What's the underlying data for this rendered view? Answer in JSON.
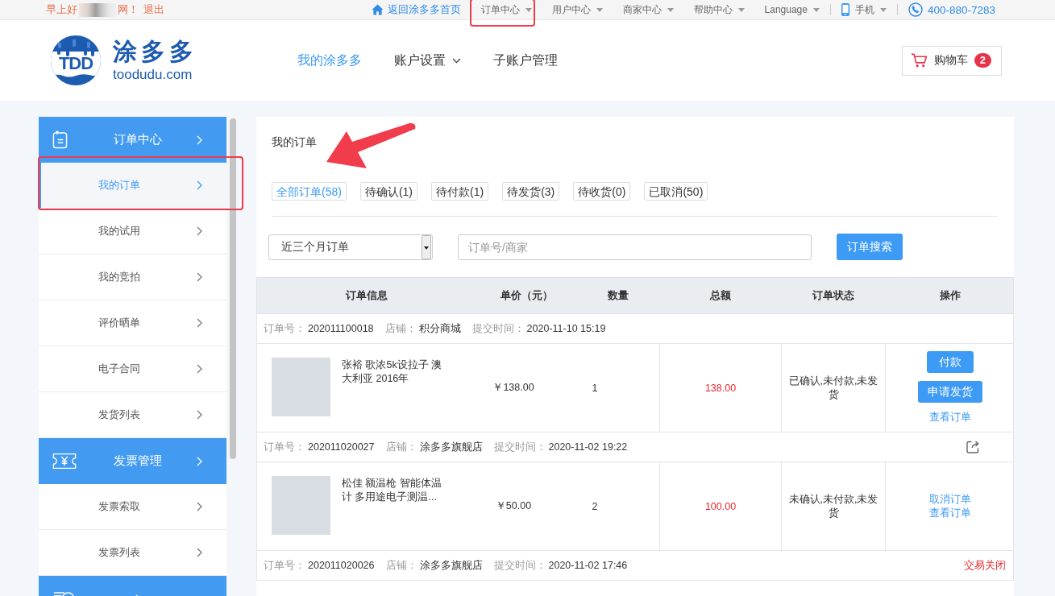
{
  "top_bar": {
    "greeting": "早上好",
    "greeting_end": "网！",
    "logout": "退出",
    "home_link": "返回涂多多首页",
    "menus": [
      {
        "label": "订单中心",
        "highlighted": true
      },
      {
        "label": "用户中心",
        "highlighted": false
      },
      {
        "label": "商家中心",
        "highlighted": false
      },
      {
        "label": "帮助中心",
        "highlighted": false
      },
      {
        "label": "Language",
        "highlighted": false
      }
    ],
    "mobile": "手机",
    "hotline": "400-880-7283"
  },
  "header": {
    "logo": {
      "initials": "TDD",
      "name": "涂多多",
      "domain": "toodudu.com"
    },
    "nav": [
      {
        "label": "我的涂多多",
        "selected": true,
        "dropdown": false
      },
      {
        "label": "账户设置",
        "selected": false,
        "dropdown": true
      },
      {
        "label": "子账户管理",
        "selected": false,
        "dropdown": false
      }
    ],
    "cart": {
      "label": "购物车",
      "count": "2"
    }
  },
  "sidebar": {
    "groups": [
      {
        "kind": "section",
        "title": "订单中心",
        "items": [
          {
            "label": "我的订单",
            "selected": true,
            "highlighted": true
          },
          {
            "label": "我的试用",
            "selected": false,
            "highlighted": false
          },
          {
            "label": "我的竞拍",
            "selected": false,
            "highlighted": false
          },
          {
            "label": "评价晒单",
            "selected": false,
            "highlighted": false
          },
          {
            "label": "电子合同",
            "selected": false,
            "highlighted": false
          },
          {
            "label": "发货列表",
            "selected": false,
            "highlighted": false
          }
        ]
      },
      {
        "kind": "section",
        "title": "发票管理",
        "items": [
          {
            "label": "发票索取",
            "selected": false,
            "highlighted": false
          },
          {
            "label": "发票列表",
            "selected": false,
            "highlighted": false
          }
        ]
      },
      {
        "kind": "section"
      }
    ]
  },
  "orders_panel": {
    "title": "我的订单",
    "title_arrow": true,
    "tabs": [
      {
        "label": "全部订单(58)",
        "selected": true
      },
      {
        "label": "待确认(1)",
        "selected": false
      },
      {
        "label": "待付款(1)",
        "selected": false
      },
      {
        "label": "待发货(3)",
        "selected": false
      },
      {
        "label": "待收货(0)",
        "selected": false
      },
      {
        "label": "已取消(50)",
        "selected": false
      }
    ],
    "filters": {
      "period": "近三个月订单",
      "search": {
        "placeholder": "订单号/商家"
      },
      "search_button": "订单搜索"
    },
    "table": {
      "columns": [
        "订单信息",
        "单价（元）",
        "数量",
        "总额",
        "订单状态",
        "操作"
      ],
      "orders": [
        {
          "number_label": "订单号：",
          "number": "202011100018",
          "shop_label": "店铺：",
          "shop": "积分商城",
          "time_label": "提交时间：",
          "time": "2020-11-10 15:19",
          "shareable": false,
          "items": [
            {
              "name": "张裕 歌浓5k设拉子 澳大利亚 2016年",
              "price": "￥138.00",
              "quantity": "1",
              "total": "138.00",
              "status": "已确认,未付款,未发货",
              "actions": [
                {
                  "kind": "button",
                  "label": "付款"
                },
                {
                  "kind": "button",
                  "label": "申请发货"
                },
                {
                  "kind": "link",
                  "label": "查看订单"
                }
              ]
            }
          ]
        },
        {
          "number_label": "订单号：",
          "number": "202011020027",
          "shop_label": "店铺：",
          "shop": "涂多多旗舰店",
          "time_label": "提交时间：",
          "time": "2020-11-02 19:22",
          "shareable": true,
          "items": [
            {
              "name": "松佳 额温枪 智能体温计 多用途电子测温...",
              "price": "￥50.00",
              "quantity": "2",
              "total": "100.00",
              "status": "未确认,未付款,未发货",
              "actions": [
                {
                  "kind": "link",
                  "label": "取消订单"
                },
                {
                  "kind": "link",
                  "label": "查看订单"
                }
              ]
            }
          ]
        },
        {
          "number_label": "订单号：",
          "number": "202011020026",
          "shop_label": "店铺：",
          "shop": "涂多多旗舰店",
          "time_label": "提交时间：",
          "time": "2020-11-02 17:46",
          "shareable": false,
          "state_note": "交易关闭"
        }
      ]
    }
  }
}
